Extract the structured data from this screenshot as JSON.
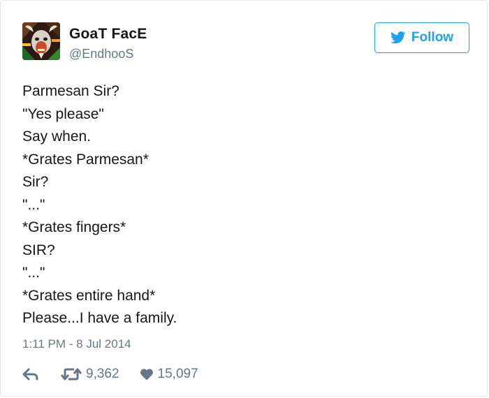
{
  "author": {
    "name": "GoaT FacE",
    "handle": "@EndhooS",
    "avatar_icon": "goat-face-avatar-icon"
  },
  "follow": {
    "label": "Follow",
    "icon": "twitter-bird-icon",
    "color": "#1da1f2"
  },
  "tweet": {
    "lines": [
      "Parmesan Sir?",
      "\"Yes please\"",
      "Say when.",
      "*Grates Parmesan*",
      "Sir?",
      "\"...\"",
      "*Grates fingers*",
      "SIR?",
      "\"...\"",
      "*Grates entire hand*",
      "Please...I have a family."
    ],
    "timestamp": "1:11 PM - 8 Jul 2014"
  },
  "actions": {
    "reply_icon": "reply-icon",
    "retweet_icon": "retweet-icon",
    "retweet_count": "9,362",
    "like_icon": "heart-icon",
    "like_count": "15,097"
  },
  "colors": {
    "text": "#14171a",
    "muted": "#657786",
    "border": "#e1e8ed",
    "accent": "#1da1f2"
  }
}
